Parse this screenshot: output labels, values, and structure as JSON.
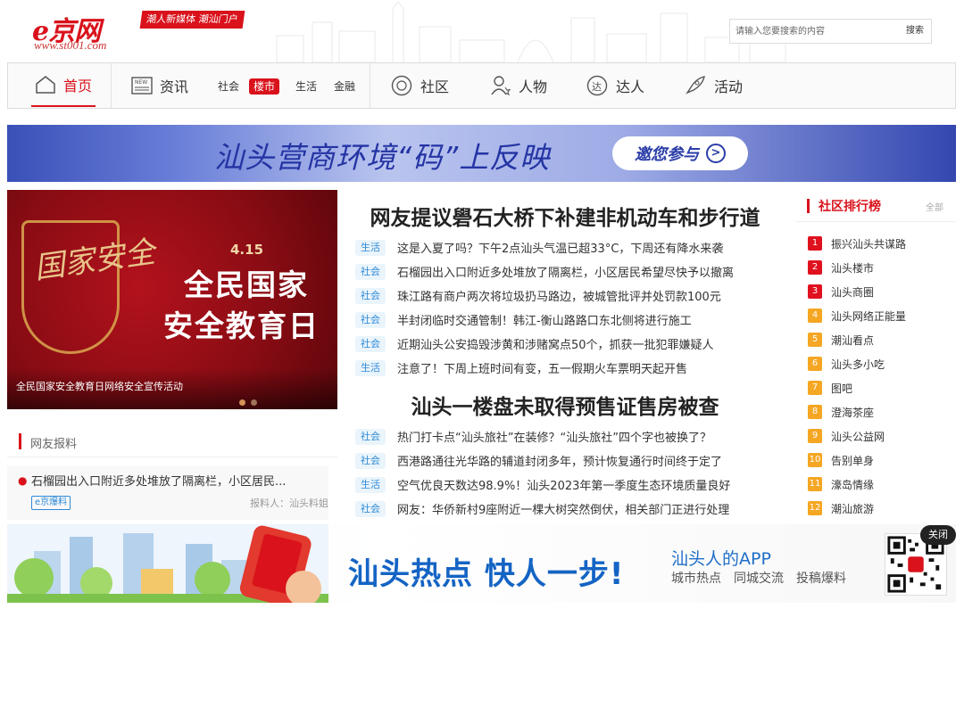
{
  "header": {
    "logo_mark": "e京网",
    "logo_slogan": "潮人新媒体 潮汕门户",
    "logo_url": "www.st001.com",
    "search_placeholder": "请输入您要搜索的内容",
    "search_button": "搜索"
  },
  "nav": {
    "home": "首页",
    "news": "资讯",
    "news_sub": [
      "社会",
      "楼市",
      "生活",
      "金融"
    ],
    "active_sub": "楼市",
    "community": "社区",
    "people": "人物",
    "experts": "达人",
    "events": "活动"
  },
  "banner": {
    "text": "汕头营商环境“码”上反映",
    "button": "邀您参与"
  },
  "hero": {
    "seal": "国家安全",
    "date": "4.15",
    "line1": "全民国家",
    "line2": "安全教育日",
    "caption": "全民国家安全教育日网络安全宣传活动"
  },
  "news": {
    "headline1": "网友提议礐石大桥下补建非机动车和步行道",
    "group1": [
      {
        "tag": "生活",
        "title": "这是入夏了吗？下午2点汕头气温已超33°C，下周还有降水来袭"
      },
      {
        "tag": "社会",
        "title": "石榴园出入口附近多处堆放了隔离栏，小区居民希望尽快予以撤离"
      },
      {
        "tag": "社会",
        "title": "珠江路有商户两次将垃圾扔马路边，被城管批评并处罚款100元"
      },
      {
        "tag": "社会",
        "title": "半封闭临时交通管制！韩江-衡山路路口东北侧将进行施工"
      },
      {
        "tag": "社会",
        "title": "近期汕头公安捣毁涉黄和涉赌窝点50个，抓获一批犯罪嫌疑人"
      },
      {
        "tag": "生活",
        "title": "注意了！下周上班时间有变，五一假期火车票明天起开售"
      }
    ],
    "headline2": "汕头一楼盘未取得预售证售房被查",
    "group2": [
      {
        "tag": "社会",
        "title": "热门打卡点“汕头旅社”在装修？“汕头旅社”四个字也被换了？"
      },
      {
        "tag": "社会",
        "title": "西港路通往光华路的辅道封闭多年，预计恢复通行时间终于定了"
      },
      {
        "tag": "生活",
        "title": "空气优良天数达98.9%！汕头2023年第一季度生态环境质量良好"
      },
      {
        "tag": "社会",
        "title": "网友：华侨新村9座附近一棵大树突然倒伏，相关部门正进行处理"
      }
    ]
  },
  "ranking": {
    "title": "社区排行榜",
    "all": "全部",
    "items": [
      {
        "num": "1",
        "name": "振兴汕头共谋路"
      },
      {
        "num": "2",
        "name": "汕头楼市"
      },
      {
        "num": "3",
        "name": "汕头商圈"
      },
      {
        "num": "4",
        "name": "汕头网络正能量"
      },
      {
        "num": "5",
        "name": "潮汕看点"
      },
      {
        "num": "6",
        "name": "汕头多小吃"
      },
      {
        "num": "7",
        "name": "图吧"
      },
      {
        "num": "8",
        "name": "澄海茶座"
      },
      {
        "num": "9",
        "name": "汕头公益网"
      },
      {
        "num": "10",
        "name": "告别单身"
      },
      {
        "num": "11",
        "name": "濠岛情缘"
      },
      {
        "num": "12",
        "name": "潮汕旅游"
      }
    ]
  },
  "report": {
    "title": "网友报料",
    "item_text": "石榴园出入口附近多处堆放了隔离栏，小区居民...",
    "badge": "e京爆料",
    "author": "报料人：汕头料姐"
  },
  "app_bar": {
    "slogan": "汕头热点 快人一步!",
    "app_name": "汕头人的APP",
    "features": [
      "城市热点",
      "同城交流",
      "投稿爆料"
    ],
    "close": "关闭"
  },
  "colors": {
    "brand_red": "#d9121b",
    "tag_blue": "#2e8ad8",
    "rank_top": "#e0111f",
    "rank_rest": "#f5a623"
  }
}
